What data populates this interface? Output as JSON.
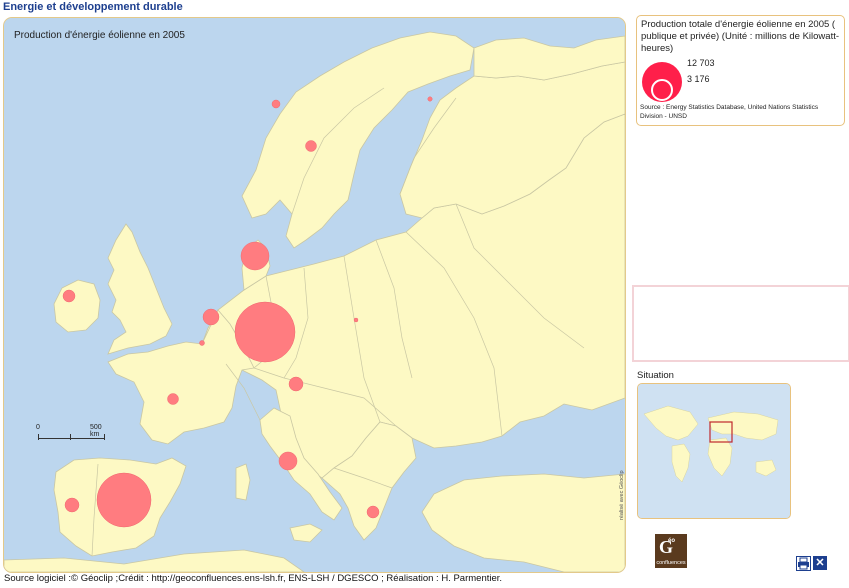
{
  "app_title": "Energie et développement durable",
  "map": {
    "title": "Production d'énergie éolienne en 2005",
    "scale": {
      "start_label": "0",
      "end_label": "500 km"
    },
    "colors": {
      "sea": "#bcd6ee",
      "land": "#fdf9c4",
      "border": "#c9c7a3",
      "symbol": "#ff7c80"
    },
    "symbols": [
      {
        "country": "Allemagne",
        "icon": "circle"
      },
      {
        "country": "Espagne",
        "icon": "circle"
      },
      {
        "country": "Danemark",
        "icon": "circle"
      },
      {
        "country": "Pays-Bas",
        "icon": "circle"
      },
      {
        "country": "Italie",
        "icon": "circle"
      },
      {
        "country": "Autriche",
        "icon": "circle"
      },
      {
        "country": "Portugal",
        "icon": "circle"
      },
      {
        "country": "Royaume-Uni / Irlande",
        "icon": "circle"
      },
      {
        "country": "France",
        "icon": "circle"
      },
      {
        "country": "Grèce",
        "icon": "circle"
      },
      {
        "country": "Suède",
        "icon": "circle"
      },
      {
        "country": "Norvège",
        "icon": "circle"
      },
      {
        "country": "Finlande",
        "icon": "circle"
      },
      {
        "country": "Pologne",
        "icon": "circle"
      },
      {
        "country": "Belgique",
        "icon": "circle"
      }
    ]
  },
  "legend": {
    "title": "Production totale d'énergie éolienne en 2005 ( publique et privée) (Unité : millions de Kilowatt-heures)",
    "value_large": "12 703",
    "value_small": "3 176",
    "source": "Source : Energy Statistics Database, United Nations Statistics Division - UNSD",
    "symbol_color": "#ff1f4a"
  },
  "situation": {
    "label": "Situation",
    "highlight_color": "#c0282d"
  },
  "vertical_credit": "réalisé avec Géoclip",
  "logo": {
    "letter": "G",
    "small": "éo",
    "sub": "confluences"
  },
  "buttons": {
    "print_icon": "printer-icon",
    "close_symbol": "✕"
  },
  "footer": "Source logiciel :© Géoclip ;Crédit : http://geoconfluences.ens-lsh.fr, ENS-LSH / DGESCO ; Réalisation : H. Parmentier."
}
